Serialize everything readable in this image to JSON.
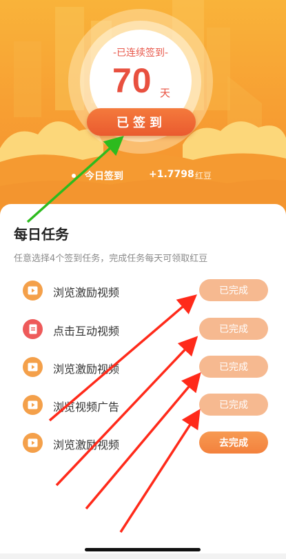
{
  "header": {
    "streak_label": "-已连续签到-",
    "streak_days": "70",
    "streak_unit": "天",
    "signed_button": "已签到",
    "today_label": "今日签到",
    "reward_value": "+1.7798",
    "reward_unit": "红豆"
  },
  "daily_tasks": {
    "title": "每日任务",
    "subtitle": "任意选择4个签到任务，完成任务每天可领取红豆",
    "items": [
      {
        "label": "浏览激励视频",
        "icon": "play-video-icon",
        "button": "已完成",
        "status": "done"
      },
      {
        "label": "点击互动视频",
        "icon": "document-icon",
        "button": "已完成",
        "status": "done"
      },
      {
        "label": "浏览激励视频",
        "icon": "play-video-icon",
        "button": "已完成",
        "status": "done"
      },
      {
        "label": "浏览视频广告",
        "icon": "play-video-icon",
        "button": "已完成",
        "status": "done"
      },
      {
        "label": "浏览激励视频",
        "icon": "play-video-icon",
        "button": "去完成",
        "status": "todo"
      }
    ]
  },
  "colors": {
    "hero_orange": "#f7a033",
    "accent_red": "#e8503f",
    "done_button": "#f6b990",
    "todo_button": "#f3813d",
    "video_icon": "#f4a04a",
    "doc_icon": "#ee5a5a",
    "annotation_arrow_red": "#ff2a1a",
    "annotation_arrow_green": "#2dbb1e"
  }
}
